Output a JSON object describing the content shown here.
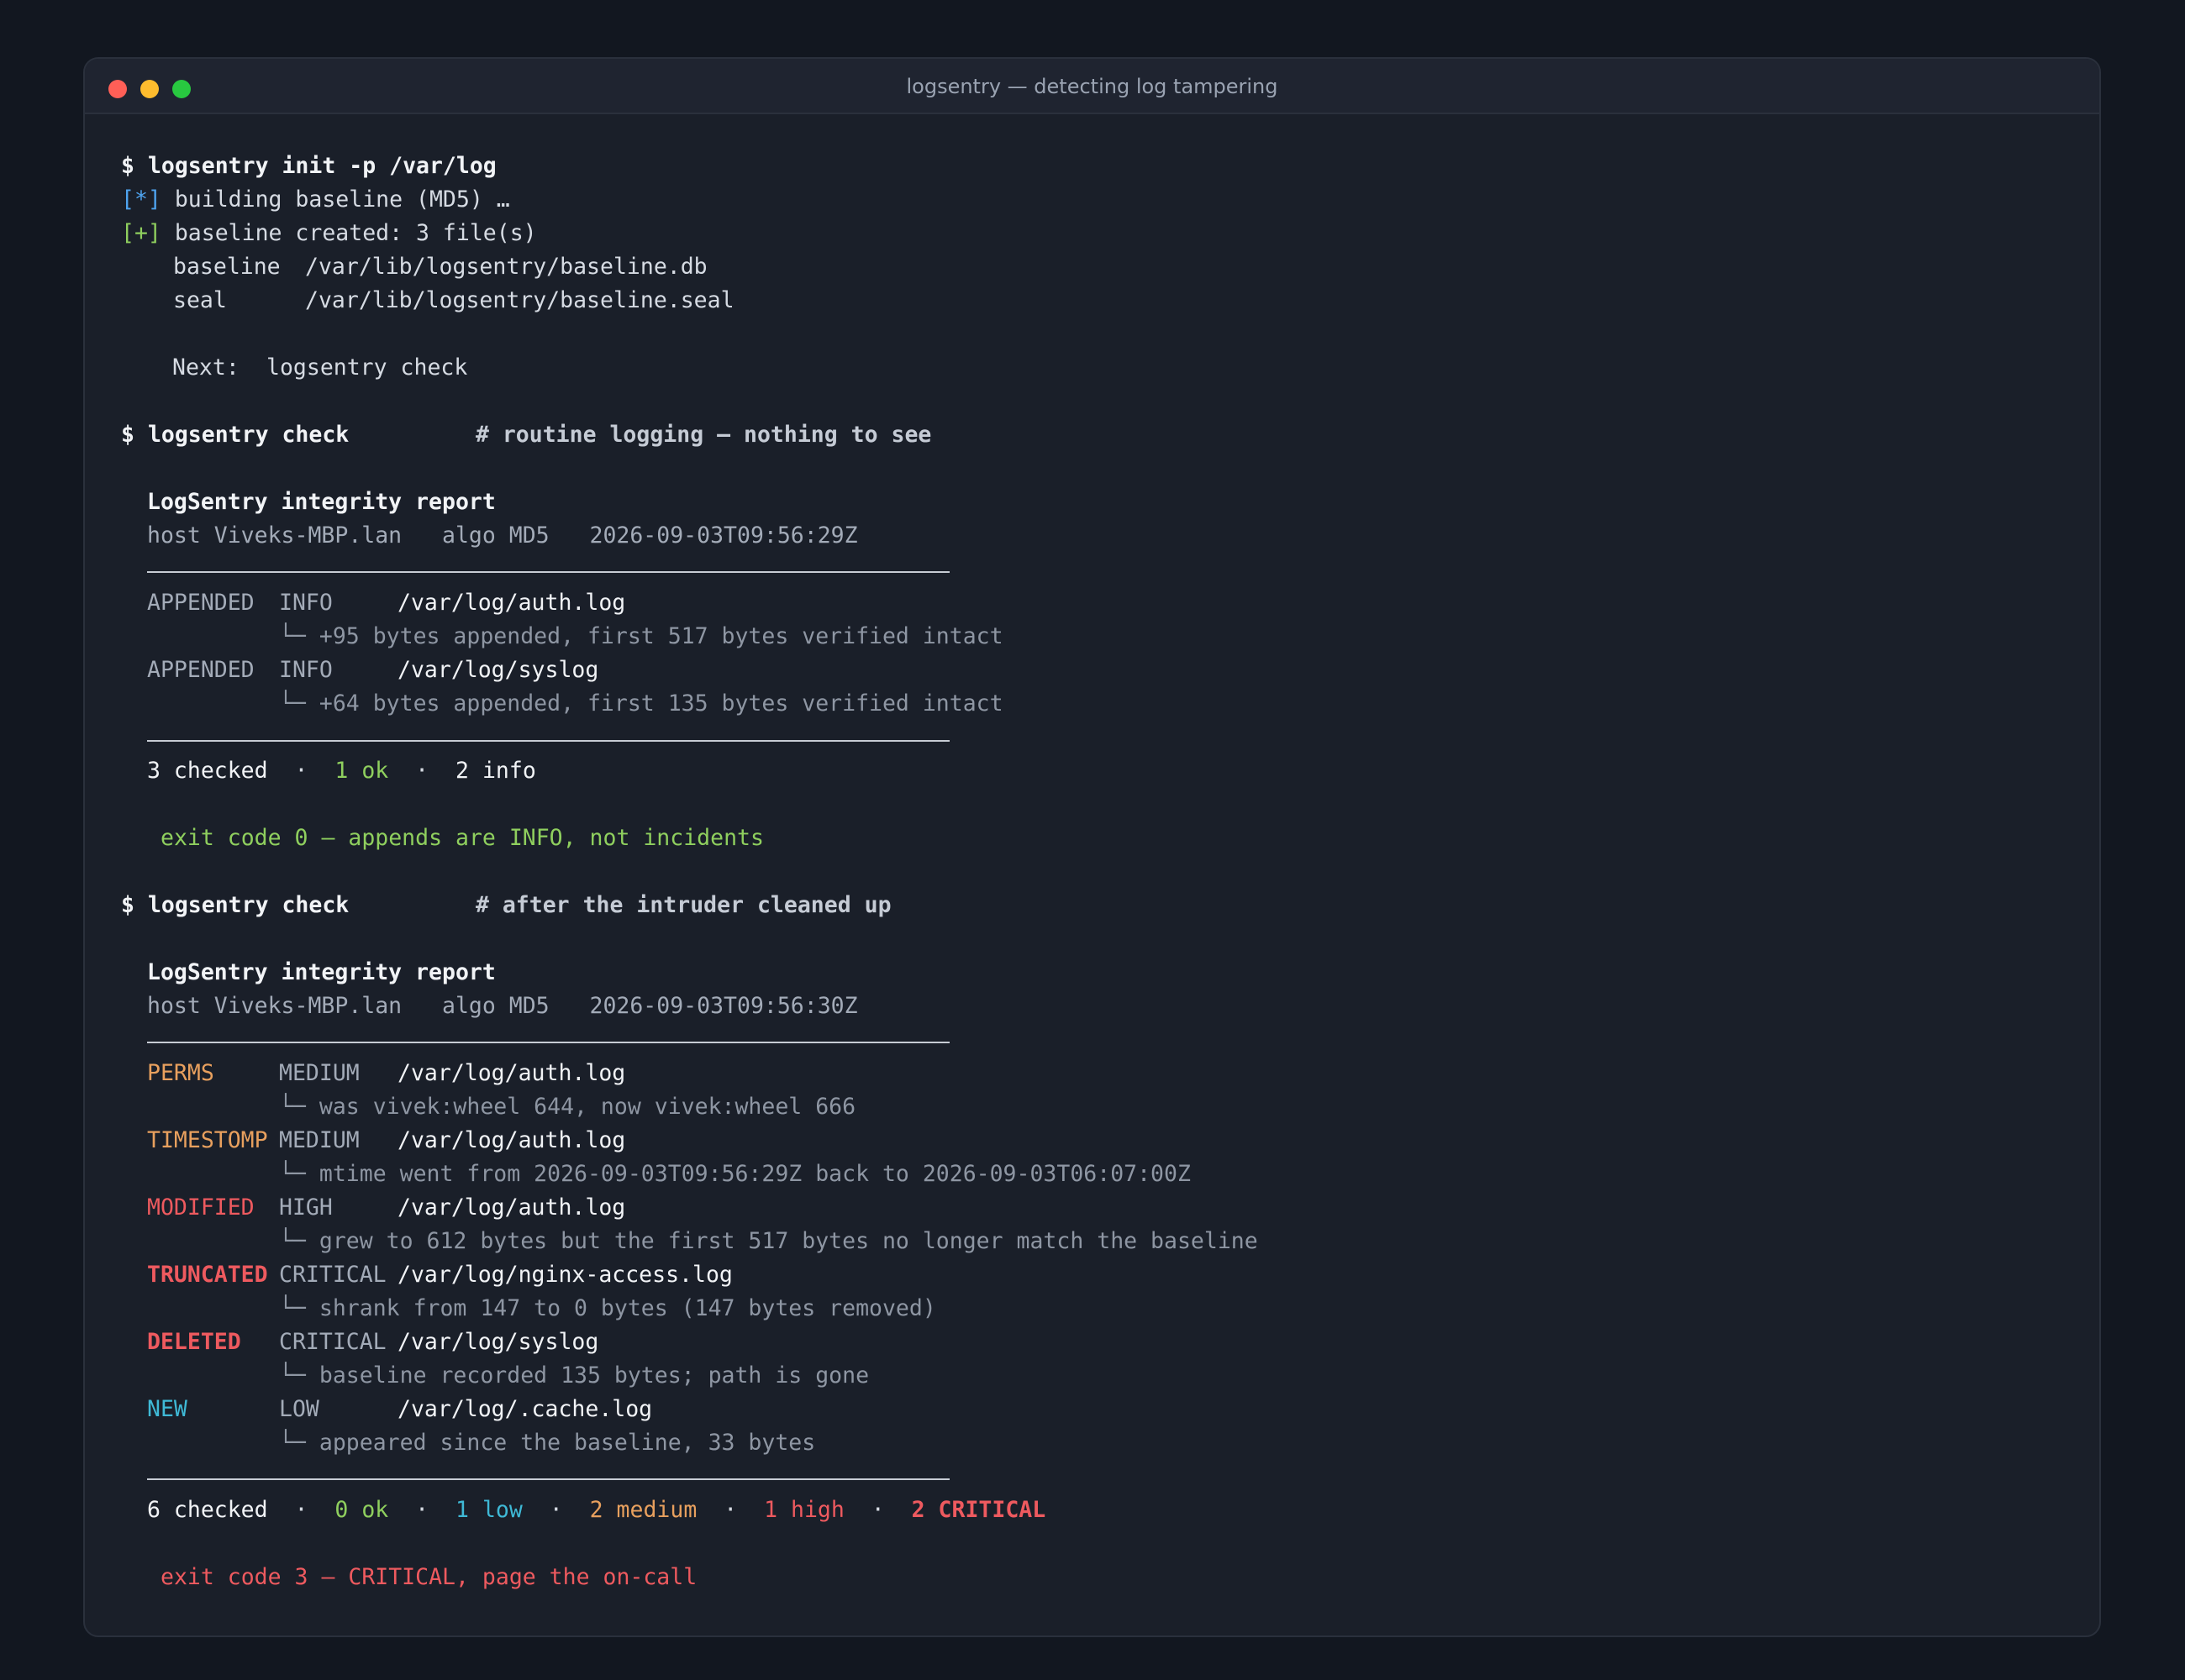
{
  "window": {
    "title": "logsentry — detecting log tampering"
  },
  "session": {
    "prompt": "$",
    "init": {
      "command": "logsentry init -p /var/log",
      "building_tag": "[*]",
      "building_text": "building baseline (MD5) …",
      "created_tag": "[+]",
      "created_text": "baseline created: 3 file(s)",
      "baseline_key": "baseline",
      "baseline_path": "/var/lib/logsentry/baseline.db",
      "seal_key": "seal",
      "seal_path": "/var/lib/logsentry/baseline.seal",
      "next_label": "Next:",
      "next_cmd": "logsentry check"
    },
    "check1": {
      "command": "logsentry check",
      "comment": "# routine logging — nothing to see",
      "report_title": "LogSentry integrity report",
      "meta": "host Viveks-MBP.lan   algo MD5   2026-09-03T09:56:29Z",
      "findings": [
        {
          "status": "APPENDED",
          "severity": "INFO",
          "path": "/var/log/auth.log",
          "detail": "+95 bytes appended, first 517 bytes verified intact"
        },
        {
          "status": "APPENDED",
          "severity": "INFO",
          "path": "/var/log/syslog",
          "detail": "+64 bytes appended, first 135 bytes verified intact"
        }
      ],
      "summary": {
        "checked": "3 checked",
        "ok": "1 ok",
        "info": "2 info"
      },
      "exit_msg": "exit code 0 — appends are INFO, not incidents"
    },
    "check2": {
      "command": "logsentry check",
      "comment": "# after the intruder cleaned up",
      "report_title": "LogSentry integrity report",
      "meta": "host Viveks-MBP.lan   algo MD5   2026-09-03T09:56:30Z",
      "findings": [
        {
          "status": "PERMS",
          "severity": "MEDIUM",
          "path": "/var/log/auth.log",
          "detail": "was vivek:wheel 644, now vivek:wheel 666"
        },
        {
          "status": "TIMESTOMP",
          "severity": "MEDIUM",
          "path": "/var/log/auth.log",
          "detail": "mtime went from 2026-09-03T09:56:29Z back to 2026-09-03T06:07:00Z"
        },
        {
          "status": "MODIFIED",
          "severity": "HIGH",
          "path": "/var/log/auth.log",
          "detail": "grew to 612 bytes but the first 517 bytes no longer match the baseline"
        },
        {
          "status": "TRUNCATED",
          "severity": "CRITICAL",
          "path": "/var/log/nginx-access.log",
          "detail": "shrank from 147 to 0 bytes (147 bytes removed)"
        },
        {
          "status": "DELETED",
          "severity": "CRITICAL",
          "path": "/var/log/syslog",
          "detail": "baseline recorded 135 bytes; path is gone"
        },
        {
          "status": "NEW",
          "severity": "LOW",
          "path": "/var/log/.cache.log",
          "detail": "appeared since the baseline, 33 bytes"
        }
      ],
      "summary": {
        "checked": "6 checked",
        "ok": "0 ok",
        "low": "1 low",
        "medium": "2 medium",
        "high": "1 high",
        "critical": "2 CRITICAL"
      },
      "exit_msg": "exit code 3 — CRITICAL, page the on-call"
    },
    "tree_glyph": "└─",
    "separator": "·"
  },
  "colors": {
    "background": "#121720",
    "window": "#1a1f29",
    "info": "#4ea3ef",
    "ok": "#8fcf5e",
    "medium": "#e8a05e",
    "high": "#ee5a5f",
    "low": "#3fb9d6"
  }
}
